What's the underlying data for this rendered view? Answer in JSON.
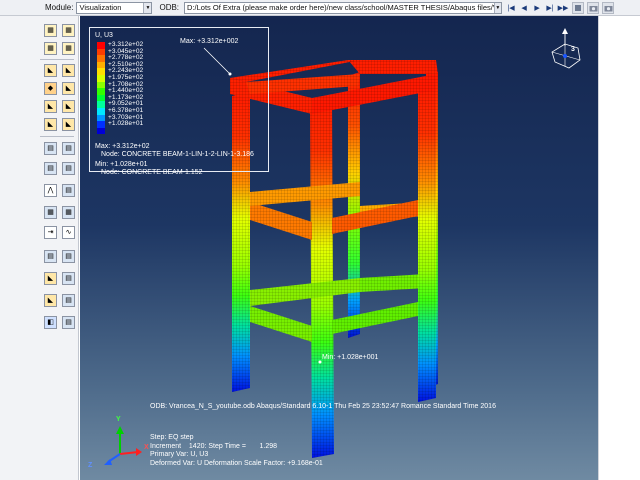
{
  "context_bar": {
    "module_label": "Module:",
    "module_value": "Visualization",
    "odb_label": "ODB:",
    "odb_path": "D:/Lots Of Extra (please make order here)/new class/school/MASTER THESIS/Abaqus files/Vrancea"
  },
  "legend": {
    "title": "U, U3",
    "entries": [
      {
        "value": "+3.312e+02",
        "color": "#ff0000"
      },
      {
        "value": "+3.045e+02",
        "color": "#ff3d00"
      },
      {
        "value": "+2.778e+02",
        "color": "#ff7300"
      },
      {
        "value": "+2.510e+02",
        "color": "#ffae00"
      },
      {
        "value": "+2.243e+02",
        "color": "#ffe000"
      },
      {
        "value": "+1.975e+02",
        "color": "#d9ff00"
      },
      {
        "value": "+1.708e+02",
        "color": "#8cff00"
      },
      {
        "value": "+1.440e+02",
        "color": "#33ff00"
      },
      {
        "value": "+1.173e+02",
        "color": "#00ff33"
      },
      {
        "value": "+9.052e+01",
        "color": "#00ff9c"
      },
      {
        "value": "+6.378e+01",
        "color": "#00e8ff"
      },
      {
        "value": "+3.703e+01",
        "color": "#0097ff"
      },
      {
        "value": "+1.028e+01",
        "color": "#0030ff"
      },
      {
        "value": "",
        "color": "#0000d6"
      }
    ],
    "max_value_line": "Max: +3.312e+02",
    "max_node_line": "Node: CONCRETE BEAM-1-LIN-1-2-LIN-1-3.186",
    "min_value_line": "Min: +1.028e+01",
    "min_node_line": "Node: CONCRETE BEAM-1.152"
  },
  "annotations": {
    "max_marker": "Max: +3.312e+002",
    "min_marker": "Min: +1.028e+001"
  },
  "odb_info": "ODB: Vrancea_N_S_youtube.odb    Abaqus/Standard 6.10-1    Thu Feb 25 23:52:47 Romance Standard Time 2016",
  "step_info": {
    "step": "Step: EQ step",
    "increment": "Increment    1420: Step Time =       1.298",
    "primary_var": "Primary Var: U, U3",
    "deformed_var": "Deformed Var: U   Deformation Scale Factor: +9.168e-01"
  },
  "triad": {
    "x": "X",
    "y": "Y",
    "z": "Z"
  },
  "view_cube_label": "3",
  "colors": {
    "viewport_top": "#14264f",
    "viewport_bottom": "#6f8aa2",
    "accent_red": "#ff0000",
    "accent_blue": "#0000d6"
  },
  "icons": [
    "module-combo-arrow",
    "odb-combo-arrow",
    "first-frame-icon",
    "previous-frame-icon",
    "play-icon",
    "next-frame-icon",
    "last-frame-icon",
    "animation-options-icon",
    "camera-icon",
    "movie-icon"
  ]
}
